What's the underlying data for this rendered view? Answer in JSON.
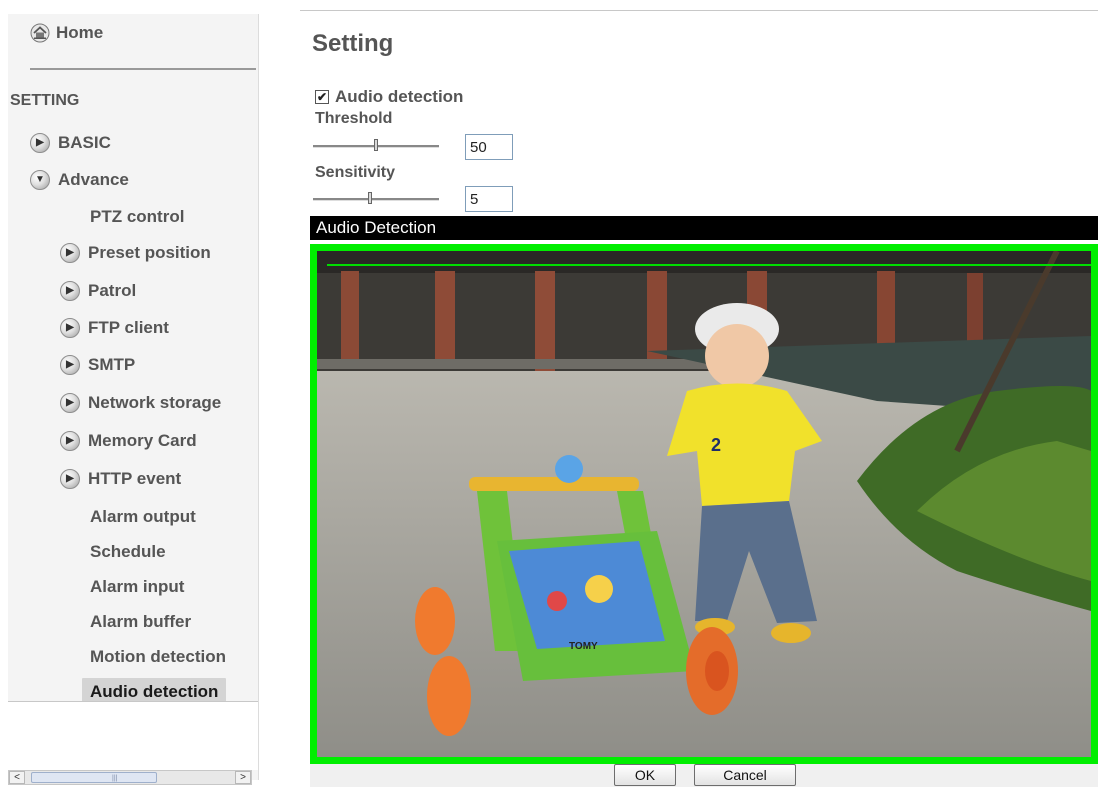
{
  "sidebar": {
    "home_label": "Home",
    "section_title": "SETTING",
    "items": [
      {
        "label": "BASIC",
        "icon": "expand-arrow-icon"
      },
      {
        "label": "Advance",
        "icon": "collapse-arrow-icon"
      },
      {
        "label": "PTZ control",
        "icon": ""
      },
      {
        "label": "Preset position",
        "icon": "expand-arrow-icon"
      },
      {
        "label": "Patrol",
        "icon": "expand-arrow-icon"
      },
      {
        "label": "FTP client",
        "icon": "expand-arrow-icon"
      },
      {
        "label": "SMTP",
        "icon": "expand-arrow-icon"
      },
      {
        "label": "Network storage",
        "icon": "expand-arrow-icon"
      },
      {
        "label": "Memory Card",
        "icon": "expand-arrow-icon"
      },
      {
        "label": "HTTP event",
        "icon": "expand-arrow-icon"
      },
      {
        "label": "Alarm output",
        "icon": ""
      },
      {
        "label": "Schedule",
        "icon": ""
      },
      {
        "label": "Alarm input",
        "icon": ""
      },
      {
        "label": "Alarm buffer",
        "icon": ""
      },
      {
        "label": "Motion detection",
        "icon": ""
      },
      {
        "label": "Audio detection",
        "icon": "",
        "selected": true
      }
    ],
    "scrollbar": {
      "left_arrow": "<",
      "right_arrow": ">",
      "grip": "|||"
    }
  },
  "main": {
    "page_title": "Setting",
    "audio_detection_checkbox": {
      "label": "Audio detection",
      "checked": true,
      "mark": "✔"
    },
    "threshold": {
      "label": "Threshold",
      "value": "50",
      "slider_fraction": 0.5
    },
    "sensitivity": {
      "label": "Sensitivity",
      "value": "5",
      "slider_fraction": 0.45
    },
    "video": {
      "header": "Audio Detection",
      "detection_box_color": "#00ee00",
      "toy_brand_text": "TOMY",
      "shirt_number": "2"
    },
    "buttons": {
      "ok": "OK",
      "cancel": "Cancel"
    }
  }
}
